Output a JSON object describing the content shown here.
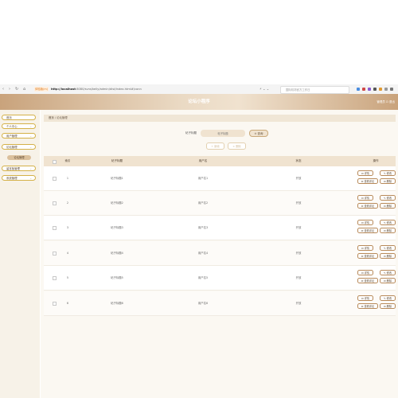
{
  "browser": {
    "nav_back": "‹",
    "nav_forward": "›",
    "nav_reload": "↻",
    "nav_home": "⌂",
    "tab_badge": "体验版(m)",
    "url_host": "http://localhost",
    "url_path": ":8080/svns/kelly/admin/dist/index.html#/conn",
    "search_placeholder": "国际机场官方工作日",
    "menu_glyphs": "⚡ ⌄ ⌄"
  },
  "header": {
    "title": "论坛小程序",
    "user": "管理员 ⊡ 退出"
  },
  "sidebar": {
    "items": [
      {
        "label": "首页",
        "arrow": ""
      },
      {
        "label": "个人中心",
        "arrow": "⌄"
      },
      {
        "label": "用户管理",
        "arrow": "⌄"
      },
      {
        "label": "论坛管理",
        "arrow": "⌄"
      },
      {
        "label": "留言板管理",
        "arrow": "⌄"
      },
      {
        "label": "系统管理",
        "arrow": "⌄"
      }
    ],
    "active_sub": "论坛管理"
  },
  "main": {
    "breadcrumb_home": "首页",
    "breadcrumb_sep": "/",
    "breadcrumb_current": "论坛管理",
    "search_label": "帖子标题",
    "search_placeholder": "帖子标题",
    "search_button": "⊙ 查询",
    "add_button": "+ 新增",
    "delete_button": "× 删除",
    "columns": [
      "索引",
      "帖子标题",
      "用户名",
      "状态",
      "操作"
    ],
    "rows": [
      {
        "index": "1",
        "title": "帖子标题1",
        "user": "用户名1",
        "status": "开放"
      },
      {
        "index": "2",
        "title": "帖子标题2",
        "user": "用户名2",
        "status": "开放"
      },
      {
        "index": "3",
        "title": "帖子标题3",
        "user": "用户名3",
        "status": "开放"
      },
      {
        "index": "4",
        "title": "帖子标题4",
        "user": "用户名4",
        "status": "开放"
      },
      {
        "index": "5",
        "title": "帖子标题5",
        "user": "用户名5",
        "status": "开放"
      },
      {
        "index": "6",
        "title": "帖子标题6",
        "user": "用户名6",
        "status": "开放"
      }
    ],
    "ops": {
      "detail": "⊡ 详情",
      "edit": "✎ 修改",
      "comment": "⊡ 查看评论",
      "delete": "⊡ 删除"
    }
  },
  "colors": {
    "accent": "#c9a37c",
    "border_gold": "#d4b148",
    "header_bg": "#f0e3d0"
  }
}
